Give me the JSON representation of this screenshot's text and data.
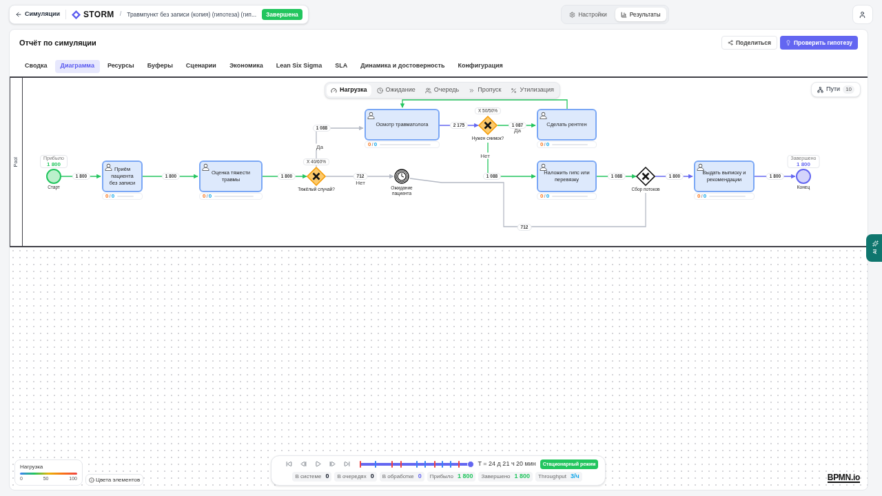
{
  "topbar": {
    "back": "Симуляции",
    "logo": "STORM",
    "breadcrumb": "Травмпункт без записи (копия) (гипотеза) (гип...",
    "status": "Завершена",
    "separator": "/",
    "modes": [
      {
        "label": "Настройки",
        "selected": false
      },
      {
        "label": "Результаты",
        "selected": true
      }
    ]
  },
  "report": {
    "title": "Отчёт по симуляции",
    "share": "Поделиться",
    "primary": "Проверить гипотезу",
    "tabs": [
      {
        "label": "Сводка",
        "selected": false
      },
      {
        "label": "Диаграмма",
        "selected": true
      },
      {
        "label": "Ресурсы",
        "selected": false
      },
      {
        "label": "Буферы",
        "selected": false
      },
      {
        "label": "Сценарии",
        "selected": false
      },
      {
        "label": "Экономика",
        "selected": false
      },
      {
        "label": "Lean Six Sigma",
        "selected": false
      },
      {
        "label": "SLA",
        "selected": false
      },
      {
        "label": "Динамика и достоверность",
        "selected": false
      },
      {
        "label": "Конфигурация",
        "selected": false
      }
    ]
  },
  "diagram": {
    "pool": "Pool",
    "views": [
      {
        "label": "Нагрузка",
        "selected": true
      },
      {
        "label": "Ожидание",
        "selected": false
      },
      {
        "label": "Очередь",
        "selected": false
      },
      {
        "label": "Пропуск",
        "selected": false
      },
      {
        "label": "Утилизация",
        "selected": false
      }
    ],
    "paths": {
      "label": "Пути",
      "count": "10"
    },
    "nodes": [
      {
        "kind": "start",
        "label": "Старт",
        "badge_label": "Прибыло",
        "badge_value": "1 800"
      },
      {
        "kind": "task",
        "label": "Приём пациента без записи",
        "queued": "0",
        "separator": "/",
        "busy": "0",
        "level": 0
      },
      {
        "kind": "task",
        "label": "Оценка тяжести травмы",
        "queued": "0",
        "separator": "/",
        "busy": "0",
        "level": 0
      },
      {
        "kind": "gateway",
        "label": "Тяжёлый случай?",
        "split": "X 40/60%",
        "color": "#fcc96b"
      },
      {
        "kind": "task",
        "label": "Осмотр травматолога",
        "queued": "0",
        "separator": "/",
        "busy": "0",
        "level": 0
      },
      {
        "kind": "timer",
        "label": "Ожидание пациента"
      },
      {
        "kind": "gateway",
        "label": "Нужен снимок?",
        "split": "X 50/50%",
        "color": "#fcc96b"
      },
      {
        "kind": "task",
        "label": "Сделать рентген",
        "queued": "0",
        "separator": "/",
        "busy": "0",
        "level": 0
      },
      {
        "kind": "task",
        "label": "Наложить гипс или перевязку",
        "queued": "0",
        "separator": "/",
        "busy": "0",
        "level": 0
      },
      {
        "kind": "gateway",
        "label": "Сбор потоков",
        "color": "#ffffff"
      },
      {
        "kind": "task",
        "label": "Выдать выписку и рекомендации",
        "queued": "0",
        "separator": "/",
        "busy": "0",
        "level": 0
      },
      {
        "kind": "end",
        "label": "Конец",
        "badge_label": "Завершено",
        "badge_value": "1 800"
      }
    ],
    "edges": [
      {
        "count": "1 800",
        "color": "#22c55e"
      },
      {
        "count": "1 800",
        "color": "#22c55e"
      },
      {
        "count": "1 800",
        "color": "#22c55e"
      },
      {
        "count": "1 088",
        "color": "#b4b9c4",
        "condition": "Да"
      },
      {
        "count": "712",
        "color": "#b4b9c4",
        "condition": "Нет"
      },
      {
        "count": "2 175",
        "color": "#6366f1"
      },
      {
        "count": "1 087",
        "color": "#22c55e",
        "condition": "Да"
      },
      {
        "count": "1 088",
        "color": "#22c55e",
        "condition": "Нет"
      },
      {
        "color": "#22c55e"
      },
      {
        "count": "712",
        "color": "#b4b9c4"
      },
      {
        "count": "1 088",
        "color": "#22c55e"
      },
      {
        "count": "1 800",
        "color": "#6366f1"
      },
      {
        "count": "1 800",
        "color": "#6366f1"
      }
    ]
  },
  "legend": {
    "title": "Нагрузка",
    "ticks": [
      "0",
      "50",
      "100"
    ]
  },
  "colors_button": "Цвета элементов",
  "player": {
    "level": 1,
    "time": "T = 24 д 21 ч 20 мин",
    "mode": "Стационарный режим",
    "stats": [
      {
        "label": "В системе",
        "value": "0"
      },
      {
        "label": "В очередях",
        "value": "0"
      },
      {
        "label": "В обработке",
        "value": "0",
        "color": "#6366f1"
      },
      {
        "label": "Прибыло",
        "value": "1 800",
        "color": "#22c55e"
      },
      {
        "label": "Завершено",
        "value": "1 800",
        "color": "#22c55e"
      },
      {
        "label": "Throughput",
        "value": "3/ч",
        "color": "#0ea5e9"
      }
    ]
  },
  "bpmn_logo": "BPMN.io",
  "ai_button": "AI"
}
